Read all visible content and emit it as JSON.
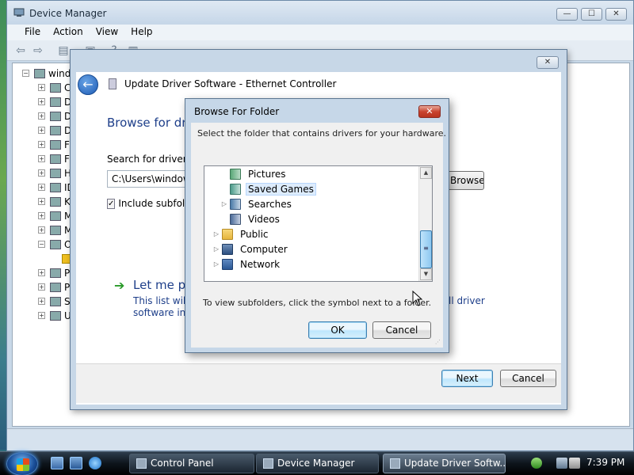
{
  "device_manager": {
    "title": "Device Manager",
    "menu": [
      "File",
      "Action",
      "View",
      "Help"
    ],
    "caption": {
      "minimize": "—",
      "maximize": "☐",
      "close": "✕"
    },
    "tree": {
      "root": "windo",
      "items": [
        "Co",
        "Di",
        "Di",
        "DV",
        "Fl",
        "Fl",
        "Hu",
        "ID",
        "Ke",
        "M",
        "M",
        "Ot",
        "",
        "Po",
        "Pr",
        "Sy",
        "Ur"
      ]
    }
  },
  "update_driver": {
    "title": "Update Driver Software - Ethernet Controller",
    "heading": "Browse for dri",
    "search_label": "Search for driver so",
    "path_value": "C:\\Users\\windows",
    "browse_button": "Browse...",
    "include_subfolders": "Include subfold",
    "include_checked": "✓",
    "letme_title": "Let me pic",
    "desc_line1": "This list will s",
    "desc_line1_end": "ll driver",
    "desc_line2": "software in th",
    "next_button": "Next",
    "cancel_button": "Cancel",
    "close": "✕"
  },
  "browse_folder": {
    "title": "Browse For Folder",
    "instruction": "Select the folder that contains drivers for your hardware.",
    "folders": [
      {
        "label": "Pictures",
        "expander": ""
      },
      {
        "label": "Saved Games",
        "expander": "",
        "selected": true
      },
      {
        "label": "Searches",
        "expander": "▷"
      },
      {
        "label": "Videos",
        "expander": ""
      },
      {
        "label": "Public",
        "expander": "▷"
      },
      {
        "label": "Computer",
        "expander": "▷"
      },
      {
        "label": "Network",
        "expander": "▷"
      }
    ],
    "hint": "To view subfolders, click the symbol next to a folder.",
    "ok_button": "OK",
    "cancel_button": "Cancel",
    "close": "✕"
  },
  "taskbar": {
    "tasks": [
      "Control Panel",
      "Device Manager",
      "Update Driver Softw..."
    ],
    "clock": "7:39 PM"
  }
}
